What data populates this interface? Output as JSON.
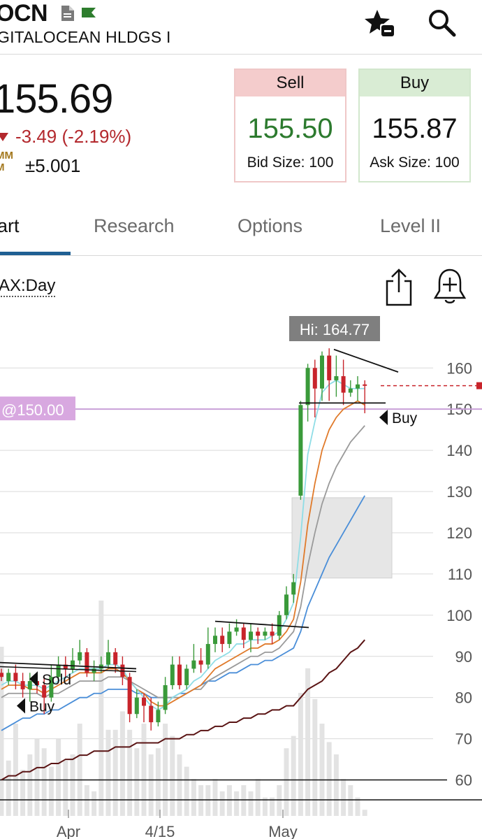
{
  "header": {
    "ticker": "OCN",
    "company": "GITALOCEAN HLDGS I"
  },
  "quote": {
    "last": "155.69",
    "change": "-3.49 (-2.19%)",
    "mm_badge_line1": "MM",
    "mm_badge_line2": "M",
    "mm_value": "±5.001",
    "sell": {
      "label": "Sell",
      "price": "155.50",
      "size_label": "Bid Size: 100"
    },
    "buy": {
      "label": "Buy",
      "price": "155.87",
      "size_label": "Ask Size: 100"
    }
  },
  "tabs": [
    {
      "label": "art",
      "active": true
    },
    {
      "label": "Research",
      "active": false
    },
    {
      "label": "Options",
      "active": false
    },
    {
      "label": "Level II",
      "active": false
    }
  ],
  "chart_toolbar": {
    "study_label": "AX:Day"
  },
  "colors": {
    "up": "#3a9a3a",
    "down": "#c8242b",
    "ema_short": "#8fdde6",
    "ema_mid": "#e07a2a",
    "sma_gray": "#9a9a9a",
    "sma_blue": "#4a8ed8",
    "sma_long": "#5a1414",
    "order_line": "#c9a0d8",
    "order_label_bg": "#d8a8e0",
    "hi_label_bg": "#7f7f7f",
    "last_price_dash": "#c8242b"
  },
  "chart_data": {
    "type": "candlestick",
    "ylim": [
      55,
      167
    ],
    "y_ticks": [
      "160",
      "150",
      "140",
      "130",
      "120",
      "110",
      "100",
      "90",
      "80",
      "70",
      "60"
    ],
    "x_ticks": [
      "Apr",
      "4/15",
      "May"
    ],
    "hi_label": "Hi: 164.77",
    "order_label": "@150.00",
    "annotations": [
      "Sold",
      "Buy",
      "Buy"
    ],
    "candles": [
      [
        86,
        85,
        87,
        84
      ],
      [
        84,
        86,
        87,
        83
      ],
      [
        86,
        84,
        88,
        82
      ],
      [
        84,
        82,
        86,
        80
      ],
      [
        82,
        84,
        86,
        79
      ],
      [
        84,
        83,
        86,
        81
      ],
      [
        83,
        80,
        85,
        76
      ],
      [
        80,
        85,
        88,
        79
      ],
      [
        85,
        88,
        90,
        84
      ],
      [
        88,
        87,
        90,
        85
      ],
      [
        87,
        89,
        92,
        86
      ],
      [
        89,
        91,
        94,
        88
      ],
      [
        91,
        86,
        92,
        85
      ],
      [
        86,
        87,
        89,
        84
      ],
      [
        87,
        88,
        90,
        86
      ],
      [
        88,
        91,
        94,
        87
      ],
      [
        91,
        88,
        92,
        86
      ],
      [
        88,
        85,
        90,
        83
      ],
      [
        85,
        76,
        86,
        74
      ],
      [
        76,
        80,
        82,
        75
      ],
      [
        80,
        78,
        81,
        74
      ],
      [
        78,
        74,
        80,
        72
      ],
      [
        74,
        77,
        79,
        73
      ],
      [
        77,
        83,
        85,
        76
      ],
      [
        83,
        88,
        90,
        82
      ],
      [
        88,
        83,
        90,
        82
      ],
      [
        83,
        87,
        88,
        82
      ],
      [
        87,
        89,
        93,
        86
      ],
      [
        89,
        88,
        92,
        86
      ],
      [
        88,
        93,
        97,
        87
      ],
      [
        93,
        95,
        97,
        91
      ],
      [
        95,
        93,
        97,
        91
      ],
      [
        93,
        96,
        98,
        92
      ],
      [
        96,
        97,
        99,
        95
      ],
      [
        97,
        94,
        98,
        92
      ],
      [
        94,
        96,
        98,
        91
      ],
      [
        96,
        95,
        97,
        93
      ],
      [
        95,
        96,
        97,
        94
      ],
      [
        96,
        95,
        98,
        93
      ],
      [
        95,
        100,
        101,
        94
      ],
      [
        100,
        105,
        107,
        99
      ],
      [
        105,
        108,
        110,
        103
      ],
      [
        129,
        151,
        152,
        128
      ],
      [
        151,
        160,
        161,
        147
      ],
      [
        160,
        155,
        162,
        148
      ],
      [
        155,
        163,
        164,
        152
      ],
      [
        163,
        157,
        164.77,
        152
      ],
      [
        157,
        158,
        163,
        153
      ],
      [
        158,
        154,
        162,
        151
      ],
      [
        154,
        155,
        157,
        153
      ],
      [
        155,
        156,
        158,
        152
      ],
      [
        156,
        155.69,
        157,
        149
      ]
    ],
    "ma_short": [
      83,
      84,
      84,
      83,
      83,
      83,
      82,
      83,
      84,
      85,
      86,
      87,
      87,
      87,
      87,
      88,
      88,
      87,
      84,
      82,
      80,
      78,
      77,
      78,
      80,
      81,
      82,
      84,
      85,
      87,
      89,
      90,
      91,
      93,
      93,
      94,
      94,
      94,
      95,
      96,
      99,
      103,
      119,
      139,
      147,
      154,
      156,
      157,
      156,
      155,
      155,
      155
    ],
    "ma_mid": [
      82,
      83,
      83,
      83,
      82,
      82,
      81,
      82,
      83,
      84,
      85,
      86,
      86,
      86,
      86,
      87,
      87,
      86,
      84,
      82,
      81,
      79,
      78,
      78,
      79,
      80,
      81,
      82,
      83,
      85,
      87,
      88,
      89,
      90,
      91,
      92,
      92,
      93,
      93,
      94,
      96,
      99,
      108,
      122,
      132,
      140,
      145,
      148,
      150,
      151,
      152,
      151
    ],
    "ma_gray": [
      80,
      81,
      81,
      81,
      81,
      81,
      80,
      81,
      81,
      82,
      83,
      84,
      84,
      84,
      84,
      85,
      85,
      85,
      84,
      83,
      82,
      81,
      80,
      80,
      80,
      80,
      81,
      82,
      82,
      84,
      85,
      86,
      87,
      88,
      89,
      90,
      90,
      91,
      91,
      92,
      94,
      96,
      102,
      112,
      120,
      127,
      132,
      136,
      139,
      142,
      144,
      146
    ],
    "ma_blue": [
      72,
      73,
      74,
      75,
      75,
      76,
      76,
      77,
      77,
      78,
      79,
      80,
      80,
      81,
      81,
      82,
      82,
      82,
      82,
      81,
      81,
      80,
      80,
      80,
      80,
      81,
      81,
      82,
      83,
      84,
      84,
      85,
      86,
      86,
      87,
      88,
      88,
      89,
      89,
      90,
      91,
      92,
      96,
      102,
      106,
      110,
      114,
      117,
      120,
      123,
      126,
      129
    ],
    "ma_long": [
      60,
      61,
      61,
      62,
      62,
      63,
      63,
      64,
      64,
      65,
      65,
      66,
      66,
      67,
      67,
      67,
      68,
      68,
      68,
      69,
      69,
      69,
      69,
      70,
      70,
      70,
      71,
      71,
      72,
      72,
      73,
      73,
      74,
      74,
      75,
      75,
      76,
      76,
      77,
      77,
      78,
      78,
      80,
      82,
      83,
      84,
      86,
      87,
      89,
      91,
      92,
      94
    ],
    "volume": [
      0.55,
      0.18,
      0.3,
      0.15,
      0.2,
      0.25,
      0.22,
      0.16,
      0.25,
      0.18,
      0.2,
      0.3,
      0.1,
      0.08,
      0.7,
      0.28,
      0.28,
      0.34,
      0.28,
      0.22,
      0.3,
      0.2,
      0.22,
      0.3,
      0.26,
      0.2,
      0.16,
      0.12,
      0.1,
      0.1,
      0.12,
      0.08,
      0.1,
      0.08,
      0.1,
      0.08,
      0.12,
      0.06,
      0.06,
      0.1,
      0.22,
      0.26,
      0.4,
      0.48,
      0.38,
      0.3,
      0.24,
      0.2,
      0.12,
      0.1,
      0.06,
      0.02
    ]
  }
}
